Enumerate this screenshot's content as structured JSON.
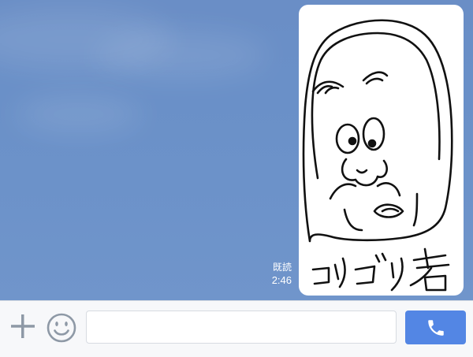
{
  "message": {
    "read_label": "既読",
    "timestamp": "2:46",
    "sticker_caption": "ゴリゴリ君"
  },
  "composer": {
    "input_value": "",
    "input_placeholder": ""
  },
  "icons": {
    "add": "plus-icon",
    "emoji": "smiley-icon",
    "call": "phone-icon"
  },
  "colors": {
    "chat_background": "#6c92c9",
    "bubble": "#ffffff",
    "accent": "#5386e4",
    "icon_gray": "#8e99a6"
  }
}
